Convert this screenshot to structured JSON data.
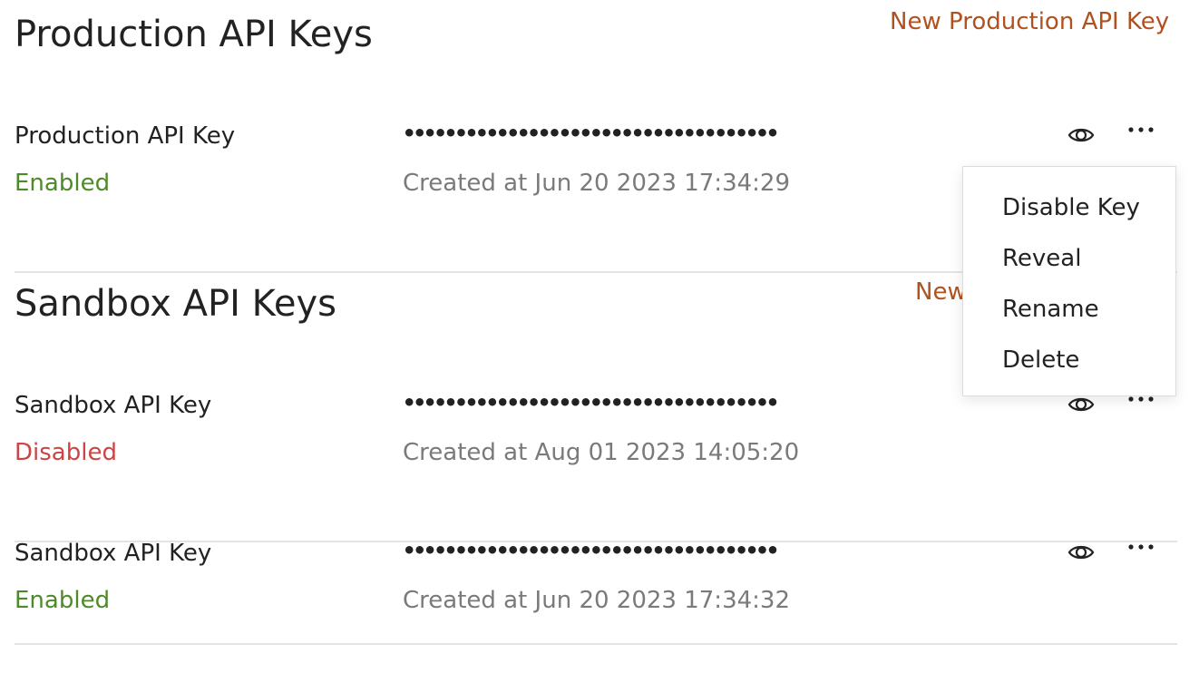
{
  "colors": {
    "accent_link": "#b0521f",
    "status_enabled": "#4e8a2a",
    "status_disabled": "#cc4444",
    "muted_text": "#7a7a7a"
  },
  "production": {
    "title": "Production API Keys",
    "new_key_label": "New Production API Key",
    "keys": [
      {
        "name": "Production API Key",
        "masked_value": "••••••••••••••••••••••••••••••••••••",
        "status": "Enabled",
        "status_color": "#4e8a2a",
        "created": "Created at Jun 20 2023 17:34:29",
        "reveal_icon": "eye-icon",
        "more_icon": "more-horizontal-icon"
      }
    ]
  },
  "sandbox": {
    "title": "Sandbox API Keys",
    "new_key_label_visible": "New",
    "keys": [
      {
        "name": "Sandbox API Key",
        "masked_value": "••••••••••••••••••••••••••••••••••••",
        "status": "Disabled",
        "status_color": "#cc4444",
        "created": "Created at Aug 01 2023 14:05:20",
        "reveal_icon": "eye-icon",
        "more_icon": "more-horizontal-icon"
      },
      {
        "name": "Sandbox API Key",
        "masked_value": "••••••••••••••••••••••••••••••••••••",
        "status": "Enabled",
        "status_color": "#4e8a2a",
        "created": "Created at Jun 20 2023 17:34:32",
        "reveal_icon": "eye-icon",
        "more_icon": "more-horizontal-icon"
      }
    ]
  },
  "context_menu": {
    "items": [
      "Disable Key",
      "Reveal",
      "Rename",
      "Delete"
    ]
  }
}
